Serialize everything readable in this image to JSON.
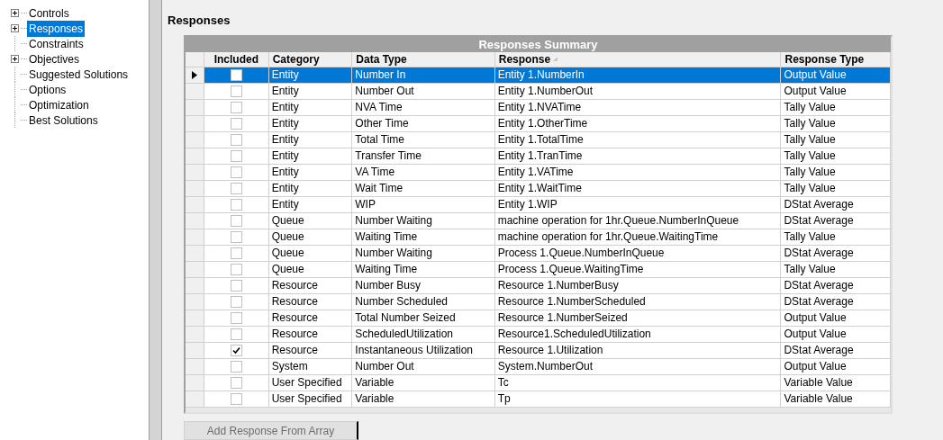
{
  "tree": [
    {
      "label": "Controls",
      "expandable": true,
      "selected": false
    },
    {
      "label": "Responses",
      "expandable": true,
      "selected": true
    },
    {
      "label": "Constraints",
      "expandable": false,
      "selected": false
    },
    {
      "label": "Objectives",
      "expandable": true,
      "selected": false
    },
    {
      "label": "Suggested Solutions",
      "expandable": false,
      "selected": false
    },
    {
      "label": "Options",
      "expandable": false,
      "selected": false
    },
    {
      "label": "Optimization",
      "expandable": false,
      "selected": false
    },
    {
      "label": "Best Solutions",
      "expandable": false,
      "selected": false
    }
  ],
  "panel_title": "Responses",
  "grid": {
    "title": "Responses Summary",
    "columns": [
      {
        "label": "Included",
        "sorted": false
      },
      {
        "label": "Category",
        "sorted": false
      },
      {
        "label": "Data Type",
        "sorted": false
      },
      {
        "label": "Response",
        "sorted": true
      },
      {
        "label": "Response Type",
        "sorted": false
      }
    ],
    "rows": [
      {
        "selected": true,
        "included": false,
        "category": "Entity",
        "data_type": "Number In",
        "response": "Entity 1.NumberIn",
        "response_type": "Output Value"
      },
      {
        "selected": false,
        "included": false,
        "category": "Entity",
        "data_type": "Number Out",
        "response": "Entity 1.NumberOut",
        "response_type": "Output Value"
      },
      {
        "selected": false,
        "included": false,
        "category": "Entity",
        "data_type": "NVA Time",
        "response": "Entity 1.NVATime",
        "response_type": "Tally Value"
      },
      {
        "selected": false,
        "included": false,
        "category": "Entity",
        "data_type": "Other Time",
        "response": "Entity 1.OtherTime",
        "response_type": "Tally Value"
      },
      {
        "selected": false,
        "included": false,
        "category": "Entity",
        "data_type": "Total Time",
        "response": "Entity 1.TotalTime",
        "response_type": "Tally Value"
      },
      {
        "selected": false,
        "included": false,
        "category": "Entity",
        "data_type": "Transfer Time",
        "response": "Entity 1.TranTime",
        "response_type": "Tally Value"
      },
      {
        "selected": false,
        "included": false,
        "category": "Entity",
        "data_type": "VA Time",
        "response": "Entity 1.VATime",
        "response_type": "Tally Value"
      },
      {
        "selected": false,
        "included": false,
        "category": "Entity",
        "data_type": "Wait Time",
        "response": "Entity 1.WaitTime",
        "response_type": "Tally Value"
      },
      {
        "selected": false,
        "included": false,
        "category": "Entity",
        "data_type": "WIP",
        "response": "Entity 1.WIP",
        "response_type": "DStat Average"
      },
      {
        "selected": false,
        "included": false,
        "category": "Queue",
        "data_type": "Number Waiting",
        "response": "machine operation for 1hr.Queue.NumberInQueue",
        "response_type": "DStat Average"
      },
      {
        "selected": false,
        "included": false,
        "category": "Queue",
        "data_type": "Waiting Time",
        "response": "machine operation for 1hr.Queue.WaitingTime",
        "response_type": "Tally Value"
      },
      {
        "selected": false,
        "included": false,
        "category": "Queue",
        "data_type": "Number Waiting",
        "response": "Process 1.Queue.NumberInQueue",
        "response_type": "DStat Average"
      },
      {
        "selected": false,
        "included": false,
        "category": "Queue",
        "data_type": "Waiting Time",
        "response": "Process 1.Queue.WaitingTime",
        "response_type": "Tally Value"
      },
      {
        "selected": false,
        "included": false,
        "category": "Resource",
        "data_type": "Number Busy",
        "response": "Resource 1.NumberBusy",
        "response_type": "DStat Average"
      },
      {
        "selected": false,
        "included": false,
        "category": "Resource",
        "data_type": "Number Scheduled",
        "response": "Resource 1.NumberScheduled",
        "response_type": "DStat Average"
      },
      {
        "selected": false,
        "included": false,
        "category": "Resource",
        "data_type": "Total Number Seized",
        "response": "Resource 1.NumberSeized",
        "response_type": "Output Value"
      },
      {
        "selected": false,
        "included": false,
        "category": "Resource",
        "data_type": "ScheduledUtilization",
        "response": "Resource1.ScheduledUtilization",
        "response_type": "Output Value"
      },
      {
        "selected": false,
        "included": true,
        "category": "Resource",
        "data_type": "Instantaneous Utilization",
        "response": "Resource 1.Utilization",
        "response_type": "DStat Average"
      },
      {
        "selected": false,
        "included": false,
        "category": "System",
        "data_type": "Number Out",
        "response": "System.NumberOut",
        "response_type": "Output Value"
      },
      {
        "selected": false,
        "included": false,
        "category": "User Specified",
        "data_type": "Variable",
        "response": "Tc",
        "response_type": "Variable Value"
      },
      {
        "selected": false,
        "included": false,
        "category": "User Specified",
        "data_type": "Variable",
        "response": "Tp",
        "response_type": "Variable Value"
      }
    ]
  },
  "button": {
    "label": "Add Response From Array",
    "disabled": true
  }
}
